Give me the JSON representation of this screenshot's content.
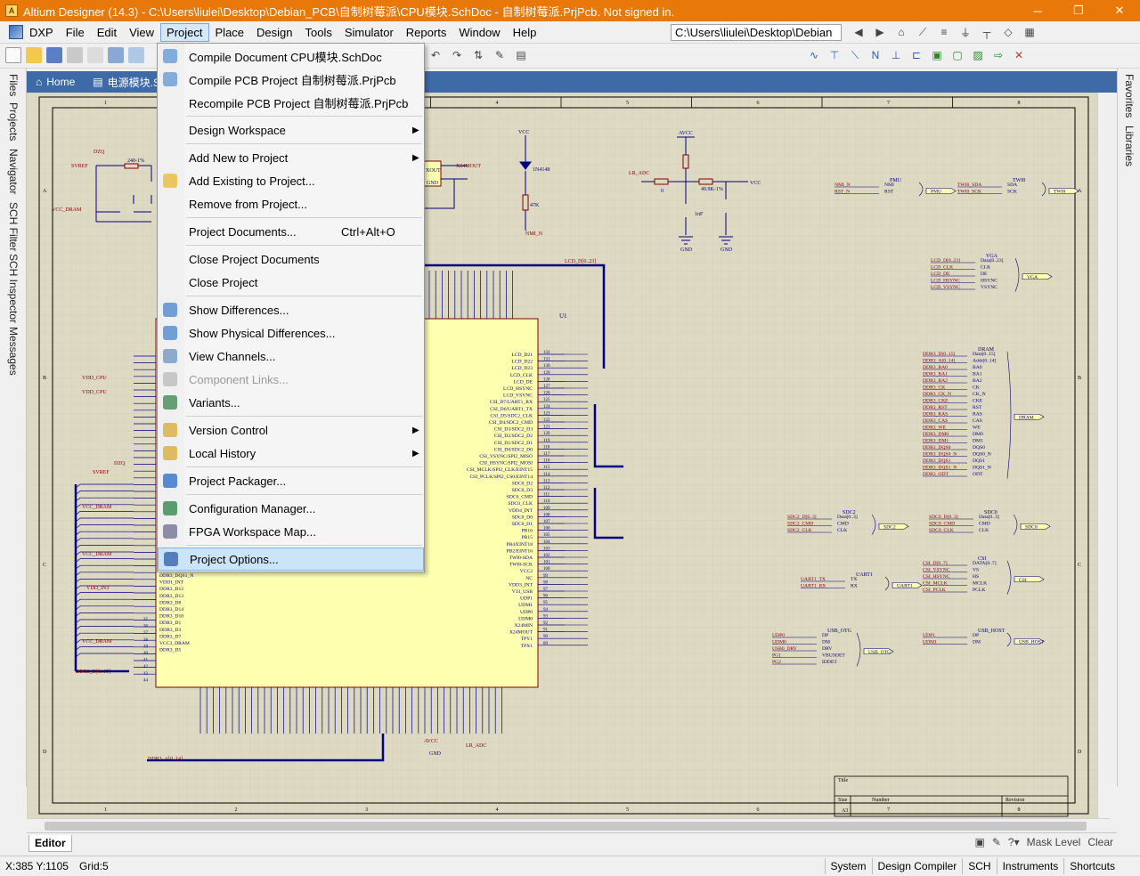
{
  "window": {
    "title": "Altium Designer (14.3) - C:\\Users\\liulei\\Desktop\\Debian_PCB\\自制树莓派\\CPU模块.SchDoc - 自制树莓派.PrjPcb. Not signed in.",
    "minimize": "─",
    "restore": "❐",
    "close": "✕"
  },
  "menubar": {
    "items": [
      "DXP",
      "File",
      "Edit",
      "View",
      "Project",
      "Place",
      "Design",
      "Tools",
      "Simulator",
      "Reports",
      "Window",
      "Help"
    ],
    "active": "Project",
    "path": "C:\\Users\\liulei\\Desktop\\Debian"
  },
  "doc_tabs": {
    "home": "Home",
    "tab2": "电源模块.S"
  },
  "left_panels": [
    "Files",
    "Projects",
    "Navigator",
    "SCH Filter",
    "SCH Inspector",
    "Messages"
  ],
  "right_panels": [
    "Favorites",
    "Libraries"
  ],
  "project_menu": {
    "items": [
      {
        "label": "Compile Document CPU模块.SchDoc",
        "shortcut": "",
        "submenu": false,
        "disabled": false,
        "icon": "compile-document-icon"
      },
      {
        "label": "Compile PCB Project 自制树莓派.PrjPcb",
        "shortcut": "",
        "submenu": false,
        "disabled": false,
        "icon": "compile-project-icon"
      },
      {
        "label": "Recompile PCB Project 自制树莓派.PrjPcb",
        "shortcut": "",
        "submenu": false,
        "disabled": false,
        "icon": ""
      },
      {
        "label": "Design Workspace",
        "shortcut": "",
        "submenu": true,
        "disabled": false,
        "icon": ""
      },
      {
        "label": "Add New to Project",
        "shortcut": "",
        "submenu": true,
        "disabled": false,
        "icon": ""
      },
      {
        "label": "Add Existing to Project...",
        "shortcut": "",
        "submenu": false,
        "disabled": false,
        "icon": "folder-open-icon"
      },
      {
        "label": "Remove from Project...",
        "shortcut": "",
        "submenu": false,
        "disabled": false,
        "icon": ""
      },
      {
        "label": "Project Documents...",
        "shortcut": "Ctrl+Alt+O",
        "submenu": false,
        "disabled": false,
        "icon": ""
      },
      {
        "label": "Close Project Documents",
        "shortcut": "",
        "submenu": false,
        "disabled": false,
        "icon": ""
      },
      {
        "label": "Close Project",
        "shortcut": "",
        "submenu": false,
        "disabled": false,
        "icon": ""
      },
      {
        "label": "Show Differences...",
        "shortcut": "",
        "submenu": false,
        "disabled": false,
        "icon": "differences-icon"
      },
      {
        "label": "Show Physical Differences...",
        "shortcut": "",
        "submenu": false,
        "disabled": false,
        "icon": "physical-differences-icon"
      },
      {
        "label": "View Channels...",
        "shortcut": "",
        "submenu": false,
        "disabled": false,
        "icon": "channels-icon"
      },
      {
        "label": "Component Links...",
        "shortcut": "",
        "submenu": false,
        "disabled": true,
        "icon": "component-links-icon"
      },
      {
        "label": "Variants...",
        "shortcut": "",
        "submenu": false,
        "disabled": false,
        "icon": "variants-icon"
      },
      {
        "label": "Version Control",
        "shortcut": "",
        "submenu": true,
        "disabled": false,
        "icon": "lock-icon"
      },
      {
        "label": "Local History",
        "shortcut": "",
        "submenu": true,
        "disabled": false,
        "icon": "lock-icon"
      },
      {
        "label": "Project Packager...",
        "shortcut": "",
        "submenu": false,
        "disabled": false,
        "icon": "packager-icon"
      },
      {
        "label": "Configuration Manager...",
        "shortcut": "",
        "submenu": false,
        "disabled": false,
        "icon": "configuration-icon"
      },
      {
        "label": "FPGA Workspace Map...",
        "shortcut": "",
        "submenu": false,
        "disabled": false,
        "icon": "fpga-map-icon"
      },
      {
        "label": "Project Options...",
        "shortcut": "",
        "submenu": false,
        "disabled": false,
        "icon": "project-options-icon",
        "highlighted": true
      }
    ]
  },
  "schematic": {
    "column_markers": [
      "1",
      "2",
      "3",
      "4",
      "5",
      "6",
      "7",
      "8"
    ],
    "row_markers": [
      "A",
      "B",
      "C",
      "D"
    ],
    "labels": {
      "u1": "U1",
      "lcd_bus": "LCD_D[0..23]",
      "ddr_bus": "DDR3_D[0..15]",
      "ddr_addr": "DDR3_A[0..14]",
      "vcc": "VCC",
      "avcc": "AVCC",
      "gnd": "GND",
      "lr_adc": "LR_ADC",
      "nmi_n": "NMI_N",
      "svref": "SVREF",
      "vcc_dram": "VCC_DRAM",
      "vdd_int": "VDD_INT",
      "vdd_cpu": "VDD_CPU",
      "dzq": "DZQ",
      "r1_val": "240-1%",
      "r4_val": "0",
      "r6_val": "49.9K-1%",
      "c5_val": "1nF",
      "d3_val": "1N4148",
      "r47k": "47K",
      "ddr3_dqs1_n": "DDR3_DQS1_N",
      "ddr3_d5": "DDR3_D5",
      "vcc3_dram": "VCC3_DRAM",
      "x24mout": "X24MOUT",
      "title_cell": "Title",
      "size_cell": "Size",
      "size_val": "A3",
      "number_cell": "Number",
      "revision_cell": "Revision"
    },
    "port_groups": [
      {
        "name": "PMU",
        "pins": [
          "NMI",
          "RST"
        ],
        "signals": [
          "NMI_N",
          "RST_N"
        ]
      },
      {
        "name": "TWI0",
        "pins": [
          "SDA",
          "SCK"
        ],
        "signals": [
          "TWI0_SDA",
          "TWI0_SCK"
        ]
      },
      {
        "name": "VGA",
        "pins": [
          "Data[0..23]",
          "CLK",
          "DE",
          "HSYNC",
          "VSYNC"
        ],
        "signals": [
          "LCD_D[0..23]",
          "LCD_CLK",
          "LCD_DE",
          "LCD_HSYNC",
          "LCD_VSYNC"
        ]
      },
      {
        "name": "DRAM",
        "pins": [
          "Data[0..15]",
          "Addr[0..14]",
          "BA0",
          "BA1",
          "BA2",
          "CK",
          "CK_N",
          "CKE",
          "RST",
          "RAS",
          "CAS",
          "WE",
          "DM0",
          "DM1",
          "DQS0",
          "DQS0_N",
          "DQS1",
          "DQS1_N",
          "ODT"
        ],
        "signals": [
          "DDR3_D[0..15]",
          "DDR3_A[0..14]",
          "DDR3_BA0",
          "DDR3_BA1",
          "DDR3_BA2",
          "DDR3_CK",
          "DDR3_CK_N",
          "DDR3_CKE",
          "DDR3_RST",
          "DDR3_RAS",
          "DDR3_CAS",
          "DDR3_WE",
          "DDR3_DM0",
          "DDR3_DM1",
          "DDR3_DQS0",
          "DDR3_DQS0_N",
          "DDR3_DQS1",
          "DDR3_DQS1_N",
          "DDR3_ODT"
        ]
      },
      {
        "name": "SDC2",
        "pins": [
          "Data[0..3]",
          "CMD",
          "CLK"
        ],
        "signals": [
          "SDC2_D[0..3]",
          "SDC2_CMD",
          "SDC2_CLK"
        ]
      },
      {
        "name": "SDC0",
        "pins": [
          "Data[0..3]",
          "CMD",
          "CLK"
        ],
        "signals": [
          "SDC0_D[0..3]",
          "SDC0_CMD",
          "SDC0_CLK"
        ]
      },
      {
        "name": "UART1",
        "pins": [
          "TX",
          "RX"
        ],
        "signals": [
          "UART1_TX",
          "UART1_RX"
        ]
      },
      {
        "name": "CSI",
        "pins": [
          "DATA[0..7]",
          "VS",
          "HS",
          "MCLK",
          "PCLK"
        ],
        "signals": [
          "CSI_D[0..7]",
          "CSI_VSYNC",
          "CSI_HSYNC",
          "CSI_MCLK",
          "CSI_PCLK"
        ]
      },
      {
        "name": "USB_OTG",
        "pins": [
          "DP",
          "DM",
          "DRV",
          "VBUSDET",
          "IDDET"
        ],
        "signals": [
          "UDP0",
          "UDM0",
          "USB0_DRV",
          "PG1",
          "PG2"
        ]
      },
      {
        "name": "USB_HOST",
        "pins": [
          "DP",
          "DM"
        ],
        "signals": [
          "UDP1",
          "UDM1"
        ]
      }
    ],
    "u1_right_pins": [
      "LCD_D21",
      "LCD_D22",
      "LCD_D23",
      "LCD_CLK",
      "LCD_DE",
      "LCD_HSYNC",
      "LCD_VSYNC",
      "CSI_D7/UART1_RX",
      "CSI_D6/UART1_TX",
      "CSI_D5/SDC2_CLK",
      "CSI_D4/SDC2_CMD",
      "CSI_D3/SDC2_D3",
      "CSI_D2/SDC2_D2",
      "CSI_D1/SDC2_D1",
      "CSI_D0/SDC2_D0",
      "CSI_VSYNC/SPI2_MISO",
      "CSI_HSYNC/SPI2_MOSI",
      "CSI_MCLK/SPI2_CLK/EINT15",
      "CSI_PCLK/SPI2_CS0/EINT14",
      "SDC0_D2",
      "SDC0_D3",
      "SDC0_CMD",
      "SDC0_CLK",
      "VDD4_INT",
      "SDC0_D0",
      "SDC0_D1",
      "PB16",
      "PB15",
      "PB4/EINT18",
      "PB2/EINT16",
      "TWI0-SDA",
      "TWI0-SCK",
      "VCC2",
      "NC",
      "VDD3_INT",
      "V33_USB",
      "UDP1",
      "UDM1",
      "UDP0",
      "UDM0",
      "X24MIN",
      "X24MOUT",
      "TPY1",
      "TPX1"
    ],
    "u1_pin_numbers": [
      "132",
      "131",
      "130",
      "129",
      "128",
      "127",
      "126",
      "125",
      "124",
      "123",
      "122",
      "121",
      "120",
      "119",
      "118",
      "117",
      "116",
      "115",
      "114",
      "113",
      "112",
      "111",
      "110",
      "109",
      "108",
      "107",
      "106",
      "105",
      "104",
      "103",
      "102",
      "101",
      "100",
      "99",
      "98",
      "97",
      "96",
      "95",
      "94",
      "93",
      "92",
      "91",
      "90",
      "89"
    ],
    "u1_left_pins": [
      "DDR3_DQS1_N",
      "VDD1_INT",
      "DDR3_D12",
      "DDR3_D13",
      "DDR3_D8",
      "DDR3_D14",
      "DDR3_D10",
      "DDR3_D1",
      "DDR3_D3",
      "DDR3_D7",
      "VCC3_DRAM",
      "DDR3_D5"
    ],
    "u1_left_numbers": [
      "35",
      "36",
      "37",
      "38",
      "39",
      "40",
      "41",
      "42",
      "43",
      "44"
    ]
  },
  "editor": {
    "tab": "Editor",
    "mask_level": "Mask Level",
    "clear": "Clear"
  },
  "status": {
    "coords": "X:385 Y:1105",
    "grid": "Grid:5",
    "panels": [
      "System",
      "Design Compiler",
      "SCH",
      "Instruments",
      "Shortcuts"
    ]
  },
  "colors": {
    "title_bar": "#e8780a",
    "sheet": "#ddd9c3",
    "component_fill": "#ffffb0",
    "wire": "#000080",
    "net_label": "#800000",
    "highlight": "#cce4f7"
  }
}
